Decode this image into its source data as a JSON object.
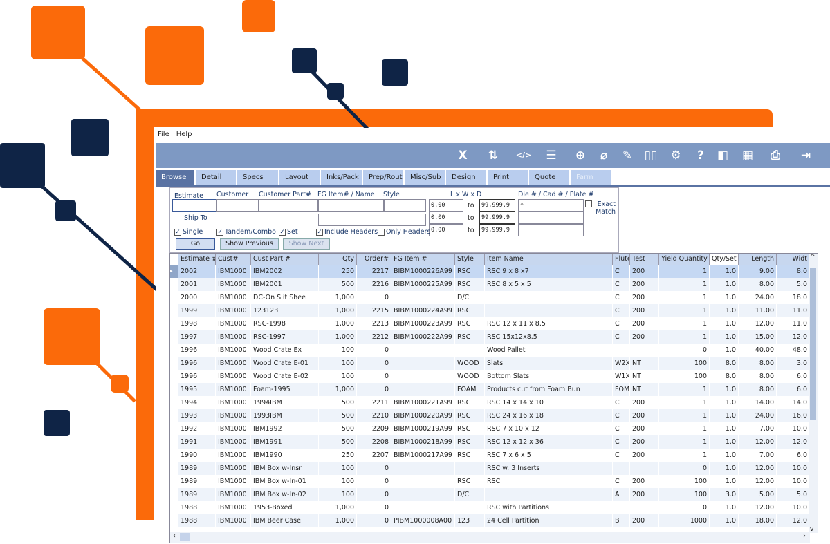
{
  "colors": {
    "accent_orange": "#fb6a0a",
    "navy": "#0f2446",
    "toolbar": "#7e99c3",
    "tab": "#b9cdee",
    "active_tab": "#5a73a3"
  },
  "menu": [
    "File",
    "Help"
  ],
  "toolbar": {
    "icons": [
      "excel-icon",
      "sort-icon",
      "code-icon",
      "report-icon",
      "add-icon",
      "attach-icon",
      "notes-check-icon",
      "book-icon",
      "window-settings-icon",
      "help-icon",
      "file-view-icon",
      "calculator-icon",
      "print-price-icon",
      "exit-icon"
    ]
  },
  "tabs": [
    {
      "label": "Browse",
      "active": true
    },
    {
      "label": "Detail"
    },
    {
      "label": "Specs"
    },
    {
      "label": "Layout"
    },
    {
      "label": "Inks/Pack"
    },
    {
      "label": "Prep/Rout"
    },
    {
      "label": "Misc/Sub"
    },
    {
      "label": "Design"
    },
    {
      "label": "Print"
    },
    {
      "label": "Quote"
    },
    {
      "label": "Farm",
      "disabled": true
    }
  ],
  "filter": {
    "labels": {
      "estimate": "Estimate",
      "customer": "Customer",
      "cust_part": "Customer Part#",
      "fg_item": "FG Item# / Name",
      "style": "Style",
      "lwd": "L x W x D",
      "die": "Die # / Cad # / Plate #",
      "ship_to": "Ship To",
      "exact": "Exact Match",
      "to": "to"
    },
    "dims": [
      {
        "from": "0.00",
        "to": "99,999.9"
      },
      {
        "from": "0.00",
        "to": "99,999.9"
      },
      {
        "from": "0.00",
        "to": "99,999.9"
      }
    ],
    "die_value": "*",
    "checks": [
      {
        "label": "Single",
        "checked": true
      },
      {
        "label": "Tandem/Combo",
        "checked": true
      },
      {
        "label": "Set",
        "checked": true
      },
      {
        "label": "Include Headers",
        "checked": true
      },
      {
        "label": "Only Headers",
        "checked": false
      }
    ],
    "exact_checked": false,
    "buttons": {
      "go": "Go",
      "prev": "Show Previous",
      "next": "Show Next"
    }
  },
  "grid": {
    "columns": [
      "Estimate #",
      "Cust#",
      "Cust Part #",
      "Qty",
      "Order#",
      "FG Item #",
      "Style",
      "Item Name",
      "Flute",
      "Test",
      "Yield Quantity",
      "Qty/Set",
      "Length",
      "Widt"
    ],
    "rows": [
      [
        "2002",
        "IBM1000",
        "IBM2002",
        "250",
        "2217",
        "BIBM1000226A99",
        "RSC",
        "RSC 9 x 8 x7",
        "C",
        "200",
        "1",
        "1.0",
        "9.00",
        "8.0"
      ],
      [
        "2001",
        "IBM1000",
        "IBM2001",
        "500",
        "2216",
        "BIBM1000225A99",
        "RSC",
        "RSC 8 x 5 x 5",
        "C",
        "200",
        "1",
        "1.0",
        "8.00",
        "5.0"
      ],
      [
        "2000",
        "IBM1000",
        "DC-On Slit Shee",
        "1,000",
        "0",
        "",
        "D/C",
        "",
        "C",
        "200",
        "1",
        "1.0",
        "24.00",
        "18.0"
      ],
      [
        "1999",
        "IBM1000",
        "123123",
        "1,000",
        "2215",
        "BIBM1000224A99",
        "RSC",
        "",
        "C",
        "200",
        "1",
        "1.0",
        "11.00",
        "11.0"
      ],
      [
        "1998",
        "IBM1000",
        "RSC-1998",
        "1,000",
        "2213",
        "BIBM1000223A99",
        "RSC",
        "RSC 12 x 11 x 8.5",
        "C",
        "200",
        "1",
        "1.0",
        "12.00",
        "11.0"
      ],
      [
        "1997",
        "IBM1000",
        "RSC-1997",
        "1,000",
        "2212",
        "BIBM1000222A99",
        "RSC",
        "RSC 15x12x8.5",
        "C",
        "200",
        "1",
        "1.0",
        "15.00",
        "12.0"
      ],
      [
        "1996",
        "IBM1000",
        "Wood Crate Ex",
        "100",
        "0",
        "",
        "",
        "Wood Pallet",
        "",
        "",
        "0",
        "1.0",
        "40.00",
        "48.0"
      ],
      [
        "1996",
        "IBM1000",
        "Wood Crate E-01",
        "100",
        "0",
        "",
        "WOOD",
        "Slats",
        "W2X",
        "NT",
        "100",
        "8.0",
        "8.00",
        "3.0"
      ],
      [
        "1996",
        "IBM1000",
        "Wood Crate E-02",
        "100",
        "0",
        "",
        "WOOD",
        "Bottom Slats",
        "W1X",
        "NT",
        "100",
        "8.0",
        "8.00",
        "6.0"
      ],
      [
        "1995",
        "IBM1000",
        "Foam-1995",
        "1,000",
        "0",
        "",
        "FOAM",
        "Products cut from Foam Bun",
        "FOM",
        "NT",
        "1",
        "1.0",
        "8.00",
        "6.0"
      ],
      [
        "1994",
        "IBM1000",
        "1994IBM",
        "500",
        "2211",
        "BIBM1000221A99",
        "RSC",
        "RSC 14 x 14 x 10",
        "C",
        "200",
        "1",
        "1.0",
        "14.00",
        "14.0"
      ],
      [
        "1993",
        "IBM1000",
        "1993IBM",
        "500",
        "2210",
        "BIBM1000220A99",
        "RSC",
        "RSC 24 x 16 x 18",
        "C",
        "200",
        "1",
        "1.0",
        "24.00",
        "16.0"
      ],
      [
        "1992",
        "IBM1000",
        "IBM1992",
        "500",
        "2209",
        "BIBM1000219A99",
        "RSC",
        "RSC 7 x 10 x 12",
        "C",
        "200",
        "1",
        "1.0",
        "7.00",
        "10.0"
      ],
      [
        "1991",
        "IBM1000",
        "IBM1991",
        "500",
        "2208",
        "BIBM1000218A99",
        "RSC",
        "RSC 12 x 12 x 36",
        "C",
        "200",
        "1",
        "1.0",
        "12.00",
        "12.0"
      ],
      [
        "1990",
        "IBM1000",
        "IBM1990",
        "250",
        "2207",
        "BIBM1000217A99",
        "RSC",
        "RSC 7 x 6 x 5",
        "C",
        "200",
        "1",
        "1.0",
        "7.00",
        "6.0"
      ],
      [
        "1989",
        "IBM1000",
        "IBM Box w-Insr",
        "100",
        "0",
        "",
        "",
        "RSC w. 3 Inserts",
        "",
        "",
        "0",
        "1.0",
        "12.00",
        "10.0"
      ],
      [
        "1989",
        "IBM1000",
        "IBM Box w-In-01",
        "100",
        "0",
        "",
        "RSC",
        "RSC",
        "C",
        "200",
        "100",
        "1.0",
        "12.00",
        "10.0"
      ],
      [
        "1989",
        "IBM1000",
        "IBM Box w-In-02",
        "100",
        "0",
        "",
        "D/C",
        "",
        "A",
        "200",
        "100",
        "3.0",
        "5.00",
        "5.0"
      ],
      [
        "1988",
        "IBM1000",
        "1953-Boxed",
        "1,000",
        "0",
        "",
        "",
        "RSC with Partitions",
        "",
        "",
        "0",
        "1.0",
        "12.00",
        "10.0"
      ],
      [
        "1988",
        "IBM1000",
        "IBM Beer Case",
        "1,000",
        "0",
        "PIBM1000008A00",
        "123",
        "24 Cell Partition",
        "B",
        "200",
        "1000",
        "1.0",
        "18.00",
        "12.0"
      ]
    ]
  }
}
